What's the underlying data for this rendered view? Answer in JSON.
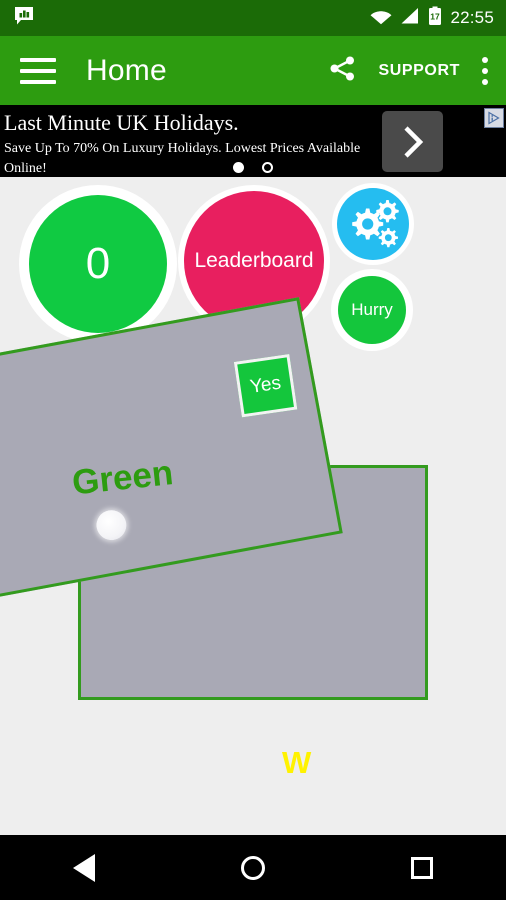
{
  "status_bar": {
    "notification_icon": "message-chart-icon",
    "wifi_icon": "wifi-icon",
    "signal_icon": "signal-icon",
    "battery_icon": "battery-icon",
    "battery_level": "17",
    "time": "22:55",
    "background_color": "#1b6b07"
  },
  "app_bar": {
    "menu_icon": "hamburger-menu-icon",
    "title": "Home",
    "share_icon": "share-icon",
    "support_label": "SUPPORT",
    "overflow_icon": "overflow-menu-icon",
    "background_color": "#2d9c10"
  },
  "ad": {
    "headline": "Last Minute UK Holidays.",
    "subtext": "Save Up To 70% On Luxury Holidays. Lowest Prices Available Online!",
    "cta_icon": "chevron-right-icon",
    "adchoices_icon": "adchoices-icon",
    "dots": [
      "filled",
      "hollow"
    ],
    "background_color": "#000000"
  },
  "board": {
    "score_label": "0",
    "score_color": "#10ca42",
    "leaderboard_label": "Leaderboard",
    "leaderboard_color": "#e81f5f",
    "settings_icon": "gears-icon",
    "settings_color": "#25bdf0",
    "hurry_label": "Hurry",
    "hurry_color": "#14c63c",
    "yes_label": "Yes",
    "yes_color": "#14c63c",
    "green_word": "Green",
    "green_word_color": "#2d9c10",
    "w_mark": "W",
    "w_mark_color": "#fff200",
    "tile_fill_color": "#a9a9b5",
    "tile_border_color": "#339b1e",
    "puck_icon": "white-puck-icon"
  },
  "nav_bar": {
    "back_icon": "back-triangle-icon",
    "home_icon": "home-circle-icon",
    "recents_icon": "recents-square-icon",
    "background_color": "#000000"
  }
}
